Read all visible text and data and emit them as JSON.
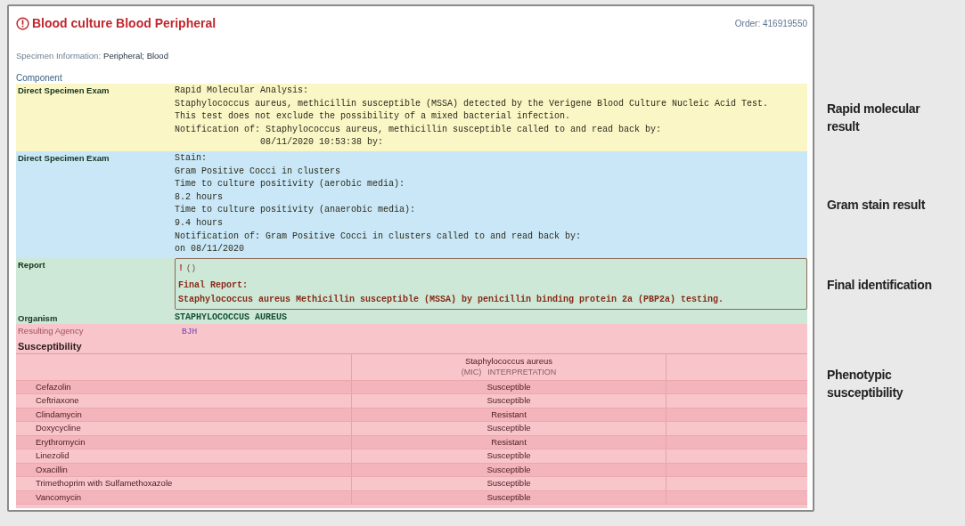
{
  "header": {
    "title": "Blood culture Blood Peripheral",
    "order": "Order: 416919550"
  },
  "specimen": {
    "label": "Specimen Information:",
    "value": "Peripheral; Blood"
  },
  "component_heading": "Component",
  "sections": [
    {
      "kind": "text",
      "color": "#fbf6c6",
      "label": "Direct Specimen Exam",
      "annotation": "Rapid molecular result",
      "lines": [
        "Rapid Molecular Analysis:",
        "Staphylococcus aureus, methicillin susceptible (MSSA) detected by the Verigene Blood Culture Nucleic Acid Test.",
        "This test does not exclude the possibility of a mixed bacterial infection.",
        "Notification of: Staphylococcus aureus, methicillin susceptible called to and read back by:",
        "                08/11/2020 10:53:38 by:"
      ]
    },
    {
      "kind": "text",
      "color": "#c9e7f7",
      "label": "Direct Specimen Exam",
      "annotation": "Gram stain result",
      "lines": [
        "Stain:",
        "Gram Positive Cocci in clusters",
        "Time to culture positivity (aerobic media):",
        "8.2 hours",
        "Time to culture positivity (anaerobic media):",
        "9.4 hours",
        "Notification of: Gram Positive Cocci in clusters called to and read back by:",
        "on 08/11/2020"
      ]
    },
    {
      "kind": "report",
      "color": "#cde8d6",
      "label": "Report",
      "annotation": "Final identification",
      "flag": "!",
      "flag_note": "()",
      "heading": "Final Report:",
      "text": "Staphylococcus aureus Methicillin susceptible (MSSA) by penicillin binding protein 2a (PBP2a) testing."
    },
    {
      "kind": "organism",
      "color": "#cde8d6",
      "label": "Organism",
      "value": "STAPHYLOCOCCUS AUREUS"
    },
    {
      "kind": "agency",
      "color": "#f8c5ca",
      "label": "Resulting Agency",
      "value": "BJH"
    },
    {
      "kind": "susceptibility",
      "color": "#f8c5ca",
      "title": "Susceptibility",
      "annotation": "Phenotypic susceptibility",
      "organism": "Staphylococcus aureus",
      "mic": "(MIC)",
      "interpretation_heading": "INTERPRETATION",
      "rows": [
        {
          "drug": "Cefazolin",
          "result": "Susceptible"
        },
        {
          "drug": "Ceftriaxone",
          "result": "Susceptible"
        },
        {
          "drug": "Clindamycin",
          "result": "Resistant"
        },
        {
          "drug": "Doxycycline",
          "result": "Susceptible"
        },
        {
          "drug": "Erythromycin",
          "result": "Resistant"
        },
        {
          "drug": "Linezolid",
          "result": "Susceptible"
        },
        {
          "drug": "Oxacillin",
          "result": "Susceptible"
        },
        {
          "drug": "Trimethoprim with Sulfamethoxazole",
          "result": "Susceptible"
        },
        {
          "drug": "Vancomycin",
          "result": "Susceptible"
        }
      ]
    }
  ]
}
